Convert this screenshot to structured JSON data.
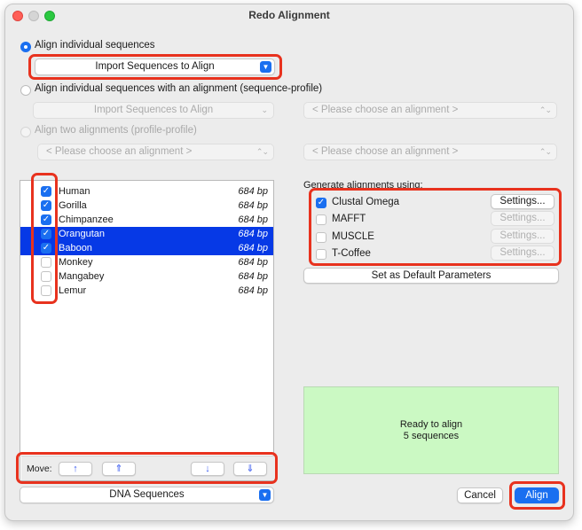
{
  "window": {
    "title": "Redo Alignment"
  },
  "mode": {
    "opt1_label": "Align individual sequences",
    "import_label": "Import Sequences to Align",
    "opt2_label": "Align individual sequences with an alignment (sequence-profile)",
    "import_label_2": "Import Sequences to Align",
    "choose_placeholder_1": "< Please choose an alignment >",
    "opt3_label": "Align two alignments (profile-profile)",
    "choose_placeholder_2": "< Please choose an alignment >",
    "choose_placeholder_3": "< Please choose an alignment >"
  },
  "sequences": [
    {
      "name": "Human",
      "bp": "684 bp",
      "checked": true,
      "selected": false
    },
    {
      "name": "Gorilla",
      "bp": "684 bp",
      "checked": true,
      "selected": false
    },
    {
      "name": "Chimpanzee",
      "bp": "684 bp",
      "checked": true,
      "selected": false
    },
    {
      "name": "Orangutan",
      "bp": "684 bp",
      "checked": true,
      "selected": true
    },
    {
      "name": "Baboon",
      "bp": "684 bp",
      "checked": true,
      "selected": true
    },
    {
      "name": "Monkey",
      "bp": "684 bp",
      "checked": false,
      "selected": false
    },
    {
      "name": "Mangabey",
      "bp": "684 bp",
      "checked": false,
      "selected": false
    },
    {
      "name": "Lemur",
      "bp": "684 bp",
      "checked": false,
      "selected": false
    }
  ],
  "move": {
    "label": "Move:",
    "buttons": [
      {
        "name": "move-up-button",
        "icon": "↑"
      },
      {
        "name": "move-top-button",
        "icon": "⇑"
      },
      {
        "name": "move-down-button",
        "icon": "↓"
      },
      {
        "name": "move-bottom-button",
        "icon": "⇓"
      }
    ]
  },
  "seq_type": {
    "value": "DNA Sequences"
  },
  "algorithms": {
    "header": "Generate alignments using:",
    "items": [
      {
        "name": "Clustal Omega",
        "checked": true,
        "settings_enabled": true
      },
      {
        "name": "MAFFT",
        "checked": false,
        "settings_enabled": false
      },
      {
        "name": "MUSCLE",
        "checked": false,
        "settings_enabled": false
      },
      {
        "name": "T-Coffee",
        "checked": false,
        "settings_enabled": false
      }
    ],
    "settings_label": "Settings...",
    "default_label": "Set as Default Parameters"
  },
  "status": {
    "line1": "Ready to align",
    "line2": "5 sequences"
  },
  "actions": {
    "cancel": "Cancel",
    "align": "Align"
  },
  "colors": {
    "accent": "#1a6ff0",
    "selection": "#0639e6",
    "highlight": "#e8321e",
    "status_bg": "#cbf9c3"
  }
}
